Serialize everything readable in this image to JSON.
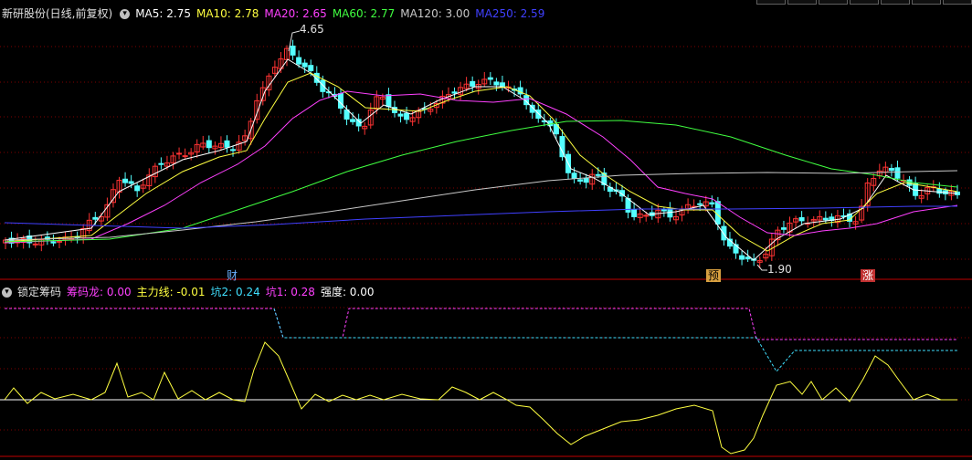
{
  "main": {
    "title": "新研股份(日线,前复权)",
    "ma": [
      {
        "label": "MA5: 2.75",
        "color": "#ffffff"
      },
      {
        "label": "MA10: 2.78",
        "color": "#ffff40"
      },
      {
        "label": "MA20: 2.65",
        "color": "#ff40ff"
      },
      {
        "label": "MA60: 2.77",
        "color": "#40ff40"
      },
      {
        "label": "MA120: 3.00",
        "color": "#c8c8c8"
      },
      {
        "label": "MA250: 2.59",
        "color": "#4040ff"
      }
    ],
    "high_label": "4.65",
    "low_label": "1.90",
    "event_tags": [
      {
        "text": "财",
        "color": "#6ab0ff",
        "bg": "#000000"
      },
      {
        "text": "预",
        "color": "#000000",
        "bg": "#d8a040"
      },
      {
        "text": "涨",
        "color": "#ffffff",
        "bg": "#c03030"
      }
    ]
  },
  "sub": {
    "title": "锁定筹码",
    "items": [
      {
        "label": "筹码龙: 0.00",
        "color": "#ff40ff"
      },
      {
        "label": "主力线: -0.01",
        "color": "#ffff40"
      },
      {
        "label": "坑2: 0.24",
        "color": "#40e0ff"
      },
      {
        "label": "坑1: 0.28",
        "color": "#ff40ff"
      },
      {
        "label": "强度: 0.00",
        "color": "#ffffff"
      }
    ]
  },
  "colors": {
    "up": "#ff3333",
    "down": "#54ffff",
    "grid": "#800000",
    "border": "#c00000"
  },
  "icons": {
    "toggle": "chevron-down-icon"
  }
}
